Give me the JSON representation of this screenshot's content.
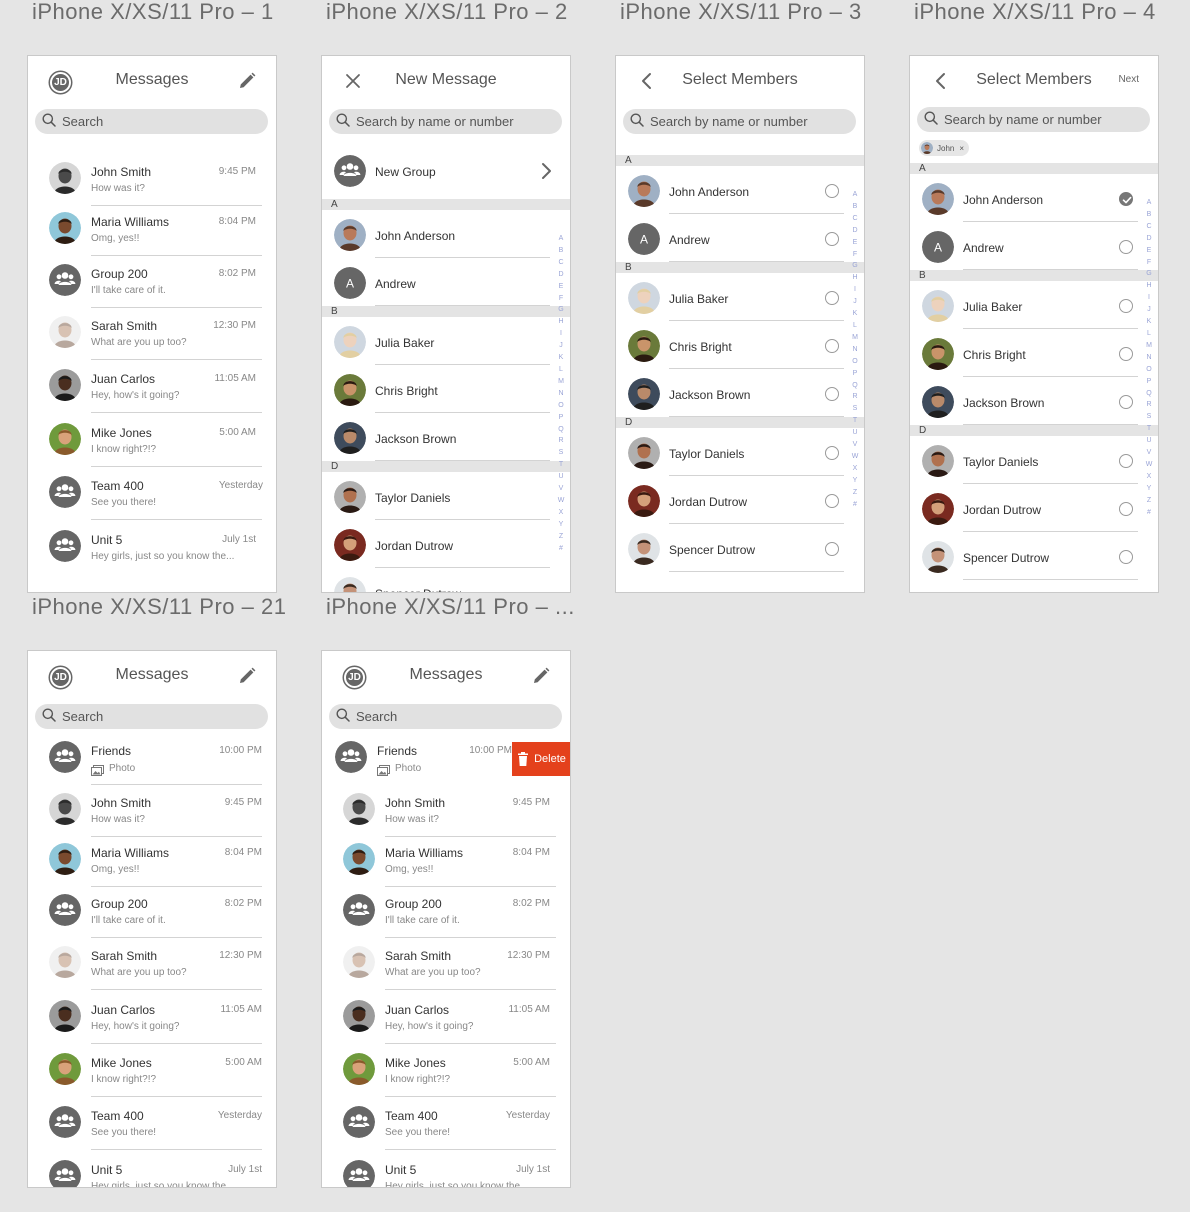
{
  "artboards": {
    "a1": {
      "title": "iPhone X/XS/11 Pro – 1"
    },
    "a2": {
      "title": "iPhone X/XS/11 Pro – 2"
    },
    "a3": {
      "title": "iPhone X/XS/11 Pro – 3"
    },
    "a4": {
      "title": "iPhone X/XS/11 Pro – 4"
    },
    "a21": {
      "title": "iPhone X/XS/11 Pro – 21"
    },
    "a22": {
      "title": "iPhone X/XS/11 Pro – ..."
    }
  },
  "messages": {
    "header_title": "Messages",
    "avatar_initials": "JD",
    "search_placeholder": "Search"
  },
  "conversations": [
    {
      "name": "John Smith",
      "preview": "How was it?",
      "time": "9:45 PM",
      "avatar": "photo-john-smith"
    },
    {
      "name": "Maria Williams",
      "preview": "Omg, yes!!",
      "time": "8:04 PM",
      "avatar": "photo-maria"
    },
    {
      "name": "Group 200",
      "preview": "I'll take care of it.",
      "time": "8:02 PM",
      "avatar": "group-icon"
    },
    {
      "name": "Sarah Smith",
      "preview": "What are you up too?",
      "time": "12:30 PM",
      "avatar": "photo-sarah"
    },
    {
      "name": "Juan Carlos",
      "preview": "Hey, how's it going?",
      "time": "11:05 AM",
      "avatar": "photo-juan"
    },
    {
      "name": "Mike Jones",
      "preview": "I know right?!?",
      "time": "5:00 AM",
      "avatar": "photo-mike"
    },
    {
      "name": "Team 400",
      "preview": "See you there!",
      "time": "Yesterday",
      "avatar": "group-icon"
    },
    {
      "name": "Unit 5",
      "preview": "Hey girls, just so you know the...",
      "time": "July 1st",
      "avatar": "group-icon"
    }
  ],
  "friends_conversation": {
    "name": "Friends",
    "preview": "Photo",
    "time": "10:00 PM",
    "avatar": "group-icon"
  },
  "delete_label": "Delete",
  "new_message": {
    "title": "New Message",
    "search_placeholder": "Search by name or number",
    "new_group_label": "New Group"
  },
  "select_members": {
    "title": "Select Members",
    "search_placeholder": "Search by name or number",
    "next_label": "Next",
    "chip_label": "John",
    "chip_close": "×"
  },
  "contact_sections": [
    {
      "letter": "A",
      "contacts": [
        {
          "name": "John Anderson",
          "selected": true,
          "avatar": "photo-john-anderson"
        },
        {
          "name": "Andrew",
          "initial": "A",
          "avatar": "initial"
        }
      ]
    },
    {
      "letter": "B",
      "contacts": [
        {
          "name": "Julia Baker",
          "avatar": "photo-julia"
        },
        {
          "name": "Chris Bright",
          "avatar": "photo-chris"
        },
        {
          "name": "Jackson Brown",
          "avatar": "photo-jackson"
        }
      ]
    },
    {
      "letter": "D",
      "contacts": [
        {
          "name": "Taylor Daniels",
          "avatar": "photo-taylor"
        },
        {
          "name": "Jordan Dutrow",
          "avatar": "photo-jordan"
        },
        {
          "name": "Spencer Dutrow",
          "avatar": "photo-spencer"
        }
      ]
    }
  ],
  "alphabet": [
    "A",
    "B",
    "C",
    "D",
    "E",
    "F",
    "G",
    "H",
    "I",
    "J",
    "K",
    "L",
    "M",
    "N",
    "O",
    "P",
    "Q",
    "R",
    "S",
    "T",
    "U",
    "V",
    "W",
    "X",
    "Y",
    "Z",
    "#"
  ],
  "colors": {
    "background": "#e5e5e5",
    "delete": "#e4411c",
    "index": "#9aa4d6",
    "icon": "#666666"
  }
}
